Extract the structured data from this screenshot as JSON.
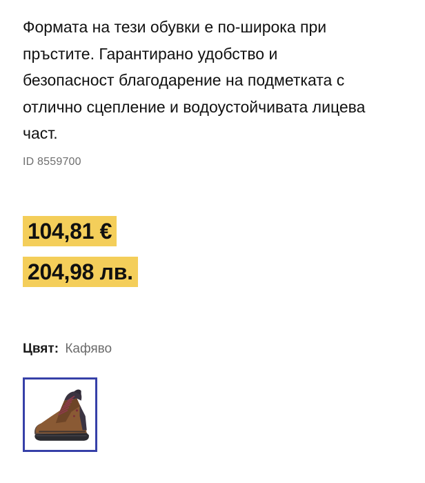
{
  "product": {
    "description_lines": [
      "Формата на тези обувки е по-широка при",
      "пръстите. Гарантирано удобство и",
      "безопасност благодарение на подметката с",
      "отлично сцепление и водоустойчивата лицева",
      "част."
    ],
    "id_text": "ID 8559700"
  },
  "pricing": {
    "eur": "104,81 €",
    "bgn": "204,98 лв.",
    "highlight_color": "#f4ce5a"
  },
  "color_selector": {
    "label": "Цвят:",
    "value": "Кафяво",
    "selected_border_color": "#3640a8",
    "swatches": [
      {
        "icon": "brown-hiking-boot-thumbnail",
        "selected": true
      }
    ]
  }
}
